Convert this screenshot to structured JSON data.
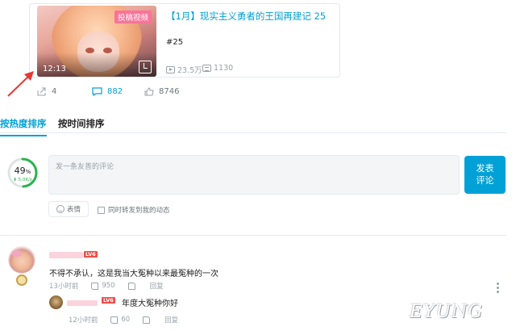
{
  "video_card": {
    "tag": "投稿视频",
    "duration": "12:13",
    "title": "【1月】现实主义勇者的王国再建记 25",
    "description": "#25",
    "plays": "23.5万",
    "danmaku": "1130"
  },
  "actions": {
    "share_count": "4",
    "comment_count": "882",
    "like_count": "8746"
  },
  "sort_tabs": {
    "hot": "按热度排序",
    "time": "按时间排序"
  },
  "gauge": {
    "percent_number": "49",
    "percent_sign": "%",
    "speed": "⬇ 5.0K/s",
    "level": 0.49
  },
  "composer": {
    "placeholder": "发一条友善的评论",
    "submit_line1": "发表",
    "submit_line2": "评论",
    "emoji_label": "表情",
    "repost_label": "同时转发到我的动态"
  },
  "comment": {
    "level_badge": "LV6",
    "text": "不得不承认，这是我当大冤种以来最冤种的一次",
    "time": "13小时前",
    "likes": "950",
    "reply_label": "回复"
  },
  "reply": {
    "level_badge": "LV6",
    "text": "年度大冤种你好",
    "time": "12小时前",
    "likes": "60",
    "reply_label": "回复"
  },
  "watermark": "EYUNG",
  "colors": {
    "accent": "#00a1d6",
    "tag_pink": "#fb7299",
    "level_red": "#f04c49",
    "gauge_green": "#2bb34d",
    "arrow_red": "#e53935"
  }
}
